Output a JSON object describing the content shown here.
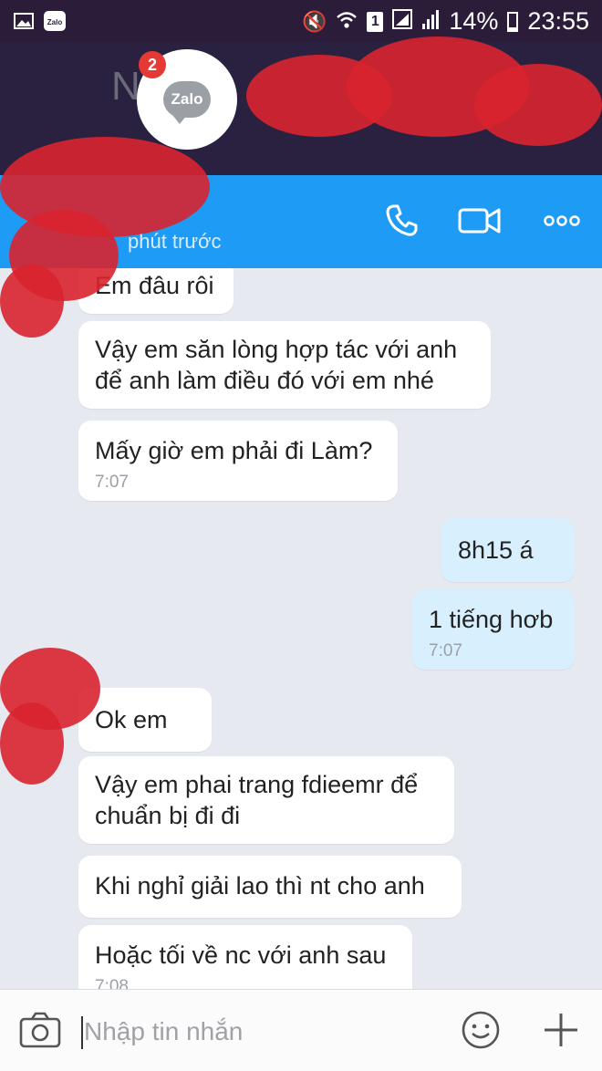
{
  "status_bar": {
    "battery": "14%",
    "time": "23:55",
    "sim_slot": "1",
    "notification_icons": [
      "image-icon",
      "zalo-app-icon"
    ]
  },
  "background_app": {
    "partial_name": "N",
    "notification_count": "2",
    "logo_text": "Zalo"
  },
  "header": {
    "subtitle": "phút trước",
    "actions": [
      "phone-icon",
      "video-call-icon",
      "more-options-icon"
    ],
    "color": "#1e9cf5"
  },
  "messages": [
    {
      "dir": "in",
      "text": "Em đâu rôi",
      "time": ""
    },
    {
      "dir": "in",
      "text": "Vậy em săn lòng hợp tác với anh\nđể anh làm điều đó với em nhé",
      "time": ""
    },
    {
      "dir": "in",
      "text": "Mấy giờ em phải đi Làm?",
      "time": "7:07"
    },
    {
      "dir": "out",
      "text": "8h15 á",
      "time": ""
    },
    {
      "dir": "out",
      "text": "1 tiếng hơb",
      "time": "7:07"
    },
    {
      "dir": "in",
      "text": "Ok em",
      "time": ""
    },
    {
      "dir": "in",
      "text": "Vậy em phai trang fdieemr để\nchuẩn bị đi đi",
      "time": ""
    },
    {
      "dir": "in",
      "text": "Khi nghỉ giải lao thì nt cho anh",
      "time": ""
    },
    {
      "dir": "in",
      "text": "Hoặc tối về nc với anh sau",
      "time": "7:08"
    }
  ],
  "composer": {
    "placeholder": "Nhập tin nhắn",
    "icons": [
      "camera-icon",
      "emoji-icon",
      "plus-icon"
    ]
  }
}
